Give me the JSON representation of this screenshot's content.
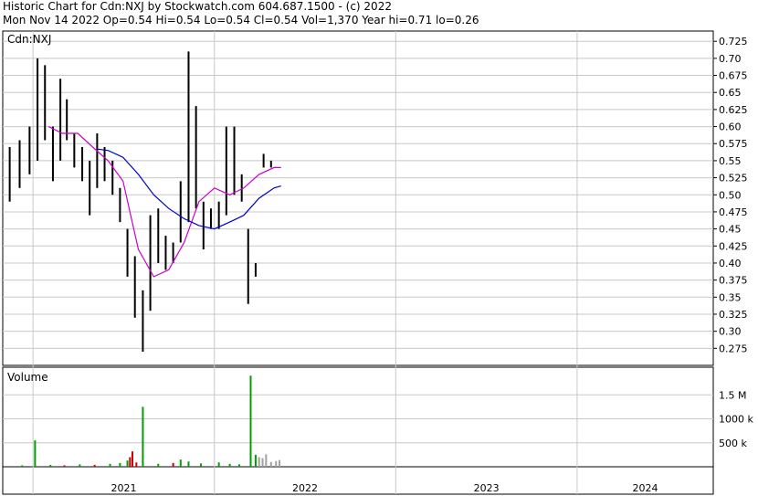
{
  "header": {
    "line1": "Historic Chart for Cdn:NXJ  by  Stockwatch.com  604.687.1500 - (c) 2022",
    "line2": "Mon Nov 14 2022   Op=0.54   Hi=0.54   Lo=0.54   Cl=0.54   Vol=1,370   Year hi=0.71   lo=0.26"
  },
  "colors": {
    "price": "#000000",
    "flat": "#cc0000",
    "ma_short": "#cc00cc",
    "ma_long": "#0000cc",
    "vol_up": "#00a000",
    "vol_down": "#cc0000",
    "vol_flat": "#a0a0a0",
    "grid": "#c8c8c8"
  },
  "chart_data": [
    {
      "type": "line",
      "panel": "price",
      "label": "Cdn:NXJ",
      "ylim": [
        0.25,
        0.74
      ],
      "y_ticks": [
        "0.725",
        "0.70",
        "0.675",
        "0.65",
        "0.625",
        "0.60",
        "0.575",
        "0.55",
        "0.525",
        "0.50",
        "0.475",
        "0.45",
        "0.425",
        "0.40",
        "0.375",
        "0.35",
        "0.325",
        "0.30",
        "0.275"
      ],
      "y_tick_values": [
        0.725,
        0.7,
        0.675,
        0.65,
        0.625,
        0.6,
        0.575,
        0.55,
        0.525,
        0.5,
        0.475,
        0.45,
        0.425,
        0.4,
        0.375,
        0.35,
        0.325,
        0.3,
        0.275
      ],
      "x_labels": [
        "2021",
        "2022",
        "2023",
        "2024"
      ],
      "x_range": [
        "2020-11",
        "2024-10"
      ],
      "grid": true,
      "price_bars": [
        {
          "x": "2020-11-15",
          "lo": 0.49,
          "hi": 0.57
        },
        {
          "x": "2020-12-05",
          "lo": 0.51,
          "hi": 0.58
        },
        {
          "x": "2020-12-25",
          "lo": 0.53,
          "hi": 0.6
        },
        {
          "x": "2021-01-10",
          "lo": 0.55,
          "hi": 0.7
        },
        {
          "x": "2021-01-25",
          "lo": 0.58,
          "hi": 0.69
        },
        {
          "x": "2021-02-10",
          "lo": 0.52,
          "hi": 0.6
        },
        {
          "x": "2021-02-25",
          "lo": 0.55,
          "hi": 0.67
        },
        {
          "x": "2021-03-10",
          "lo": 0.58,
          "hi": 0.64
        },
        {
          "x": "2021-03-25",
          "lo": 0.54,
          "hi": 0.59
        },
        {
          "x": "2021-04-10",
          "lo": 0.52,
          "hi": 0.57
        },
        {
          "x": "2021-04-25",
          "lo": 0.47,
          "hi": 0.55
        },
        {
          "x": "2021-05-10",
          "lo": 0.51,
          "hi": 0.59
        },
        {
          "x": "2021-05-25",
          "lo": 0.52,
          "hi": 0.57
        },
        {
          "x": "2021-06-10",
          "lo": 0.5,
          "hi": 0.55
        },
        {
          "x": "2021-06-25",
          "lo": 0.46,
          "hi": 0.51
        },
        {
          "x": "2021-07-10",
          "lo": 0.38,
          "hi": 0.45
        },
        {
          "x": "2021-07-25",
          "lo": 0.32,
          "hi": 0.41
        },
        {
          "x": "2021-08-10",
          "lo": 0.27,
          "hi": 0.36
        },
        {
          "x": "2021-08-25",
          "lo": 0.33,
          "hi": 0.47
        },
        {
          "x": "2021-09-10",
          "lo": 0.4,
          "hi": 0.48
        },
        {
          "x": "2021-09-25",
          "lo": 0.39,
          "hi": 0.44
        },
        {
          "x": "2021-10-10",
          "lo": 0.4,
          "hi": 0.43
        },
        {
          "x": "2021-10-25",
          "lo": 0.43,
          "hi": 0.52
        },
        {
          "x": "2021-11-10",
          "lo": 0.46,
          "hi": 0.71
        },
        {
          "x": "2021-11-25",
          "lo": 0.48,
          "hi": 0.63
        },
        {
          "x": "2021-12-10",
          "lo": 0.42,
          "hi": 0.49
        },
        {
          "x": "2021-12-25",
          "lo": 0.45,
          "hi": 0.48
        },
        {
          "x": "2022-01-10",
          "lo": 0.45,
          "hi": 0.49
        },
        {
          "x": "2022-01-25",
          "lo": 0.47,
          "hi": 0.6
        },
        {
          "x": "2022-02-10",
          "lo": 0.5,
          "hi": 0.6
        },
        {
          "x": "2022-02-25",
          "lo": 0.49,
          "hi": 0.53
        },
        {
          "x": "2022-03-10",
          "lo": 0.34,
          "hi": 0.45
        },
        {
          "x": "2022-03-25",
          "lo": 0.38,
          "hi": 0.4
        },
        {
          "x": "2022-04-10",
          "lo": 0.54,
          "hi": 0.56
        },
        {
          "x": "2022-04-25",
          "lo": 0.54,
          "hi": 0.55
        },
        {
          "x": "2022-05-10",
          "lo": 0.54,
          "hi": 0.54
        }
      ],
      "series": [
        {
          "values_x": [
            "2021-02-01",
            "2021-03-01",
            "2021-04-01",
            "2021-05-01",
            "2021-06-01",
            "2021-07-01",
            "2021-08-01",
            "2021-09-01",
            "2021-10-01",
            "2021-11-01",
            "2021-12-01",
            "2022-01-01",
            "2022-02-01",
            "2022-03-01",
            "2022-04-01",
            "2022-05-01",
            "2022-05-15"
          ],
          "values_y": [
            0.6,
            0.59,
            0.59,
            0.57,
            0.55,
            0.52,
            0.42,
            0.38,
            0.39,
            0.43,
            0.49,
            0.51,
            0.5,
            0.51,
            0.53,
            0.54,
            0.54
          ]
        },
        {
          "values_x": [
            "2021-05-10",
            "2021-06-01",
            "2021-07-01",
            "2021-08-01",
            "2021-09-01",
            "2021-10-01",
            "2021-11-01",
            "2021-12-01",
            "2022-01-01",
            "2022-02-01",
            "2022-03-01",
            "2022-04-01",
            "2022-05-01",
            "2022-05-15"
          ],
          "values_y": [
            0.567,
            0.565,
            0.555,
            0.53,
            0.5,
            0.48,
            0.465,
            0.455,
            0.45,
            0.46,
            0.47,
            0.495,
            0.51,
            0.513
          ]
        }
      ]
    },
    {
      "type": "bar",
      "panel": "volume",
      "label": "Volume",
      "ylim": [
        0,
        2000000
      ],
      "y_ticks": [
        "1.5 M",
        "1000 k",
        "500 k"
      ],
      "y_tick_values": [
        1500000,
        1000000,
        500000
      ],
      "bars": [
        {
          "x": "2020-12-10",
          "v": 30000,
          "c": "up"
        },
        {
          "x": "2021-01-05",
          "v": 550000,
          "c": "up"
        },
        {
          "x": "2021-02-05",
          "v": 40000,
          "c": "up"
        },
        {
          "x": "2021-03-05",
          "v": 30000,
          "c": "down"
        },
        {
          "x": "2021-04-05",
          "v": 50000,
          "c": "up"
        },
        {
          "x": "2021-05-05",
          "v": 40000,
          "c": "down"
        },
        {
          "x": "2021-06-05",
          "v": 60000,
          "c": "up"
        },
        {
          "x": "2021-06-25",
          "v": 80000,
          "c": "up"
        },
        {
          "x": "2021-07-10",
          "v": 130000,
          "c": "up"
        },
        {
          "x": "2021-07-15",
          "v": 200000,
          "c": "down"
        },
        {
          "x": "2021-07-20",
          "v": 320000,
          "c": "down"
        },
        {
          "x": "2021-07-28",
          "v": 90000,
          "c": "down"
        },
        {
          "x": "2021-08-10",
          "v": 1250000,
          "c": "up"
        },
        {
          "x": "2021-09-10",
          "v": 60000,
          "c": "up"
        },
        {
          "x": "2021-10-10",
          "v": 80000,
          "c": "down"
        },
        {
          "x": "2021-10-25",
          "v": 150000,
          "c": "up"
        },
        {
          "x": "2021-11-10",
          "v": 110000,
          "c": "up"
        },
        {
          "x": "2021-12-05",
          "v": 70000,
          "c": "up"
        },
        {
          "x": "2022-01-10",
          "v": 90000,
          "c": "up"
        },
        {
          "x": "2022-02-01",
          "v": 60000,
          "c": "up"
        },
        {
          "x": "2022-02-20",
          "v": 50000,
          "c": "up"
        },
        {
          "x": "2022-03-15",
          "v": 1900000,
          "c": "up"
        },
        {
          "x": "2022-03-25",
          "v": 250000,
          "c": "up"
        },
        {
          "x": "2022-04-01",
          "v": 200000,
          "c": "flat"
        },
        {
          "x": "2022-04-08",
          "v": 180000,
          "c": "flat"
        },
        {
          "x": "2022-04-15",
          "v": 260000,
          "c": "flat"
        },
        {
          "x": "2022-04-25",
          "v": 100000,
          "c": "flat"
        },
        {
          "x": "2022-05-05",
          "v": 120000,
          "c": "flat"
        },
        {
          "x": "2022-05-12",
          "v": 140000,
          "c": "flat"
        }
      ]
    }
  ]
}
